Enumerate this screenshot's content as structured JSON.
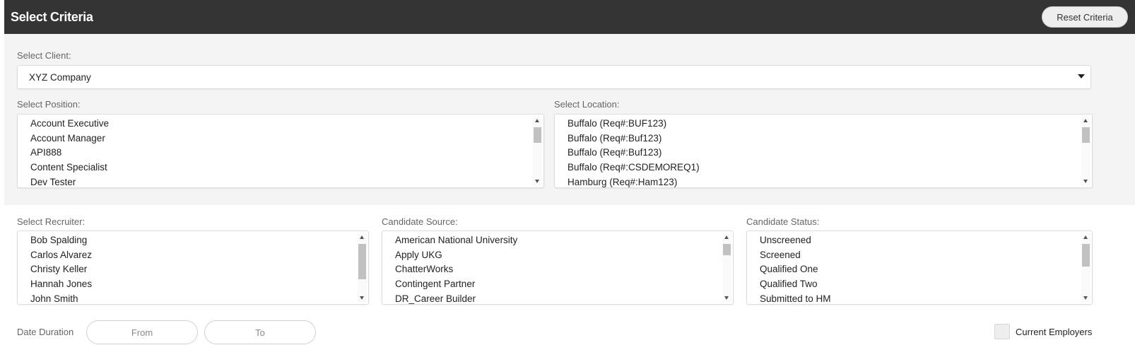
{
  "header": {
    "title": "Select Criteria",
    "reset_label": "Reset Criteria"
  },
  "client": {
    "label": "Select Client:",
    "value": "XYZ Company"
  },
  "position": {
    "label": "Select Position:",
    "items": [
      "Account Executive",
      "Account Manager",
      "API888",
      "Content Specialist",
      "Dev Tester"
    ]
  },
  "location": {
    "label": "Select Location:",
    "items": [
      "Buffalo (Req#:BUF123)",
      "Buffalo (Req#:Buf123)",
      "Buffalo (Req#:Buf123)",
      "Buffalo (Req#:CSDEMOREQ1)",
      "Hamburg (Req#:Ham123)"
    ]
  },
  "recruiter": {
    "label": "Select Recruiter:",
    "items": [
      "Bob Spalding",
      "Carlos Alvarez",
      "Christy Keller",
      "Hannah Jones",
      "John Smith"
    ]
  },
  "source": {
    "label": "Candidate Source:",
    "items": [
      "American National University",
      "Apply UKG",
      "ChatterWorks",
      "Contingent Partner",
      "DR_Career Builder"
    ]
  },
  "status": {
    "label": "Candidate Status:",
    "items": [
      "Unscreened",
      "Screened",
      "Qualified One",
      "Qualified Two",
      "Submitted to HM"
    ]
  },
  "date": {
    "label": "Date Duration",
    "from_placeholder": "From",
    "to_placeholder": "To"
  },
  "current_employers": {
    "label": "Current Employers"
  }
}
